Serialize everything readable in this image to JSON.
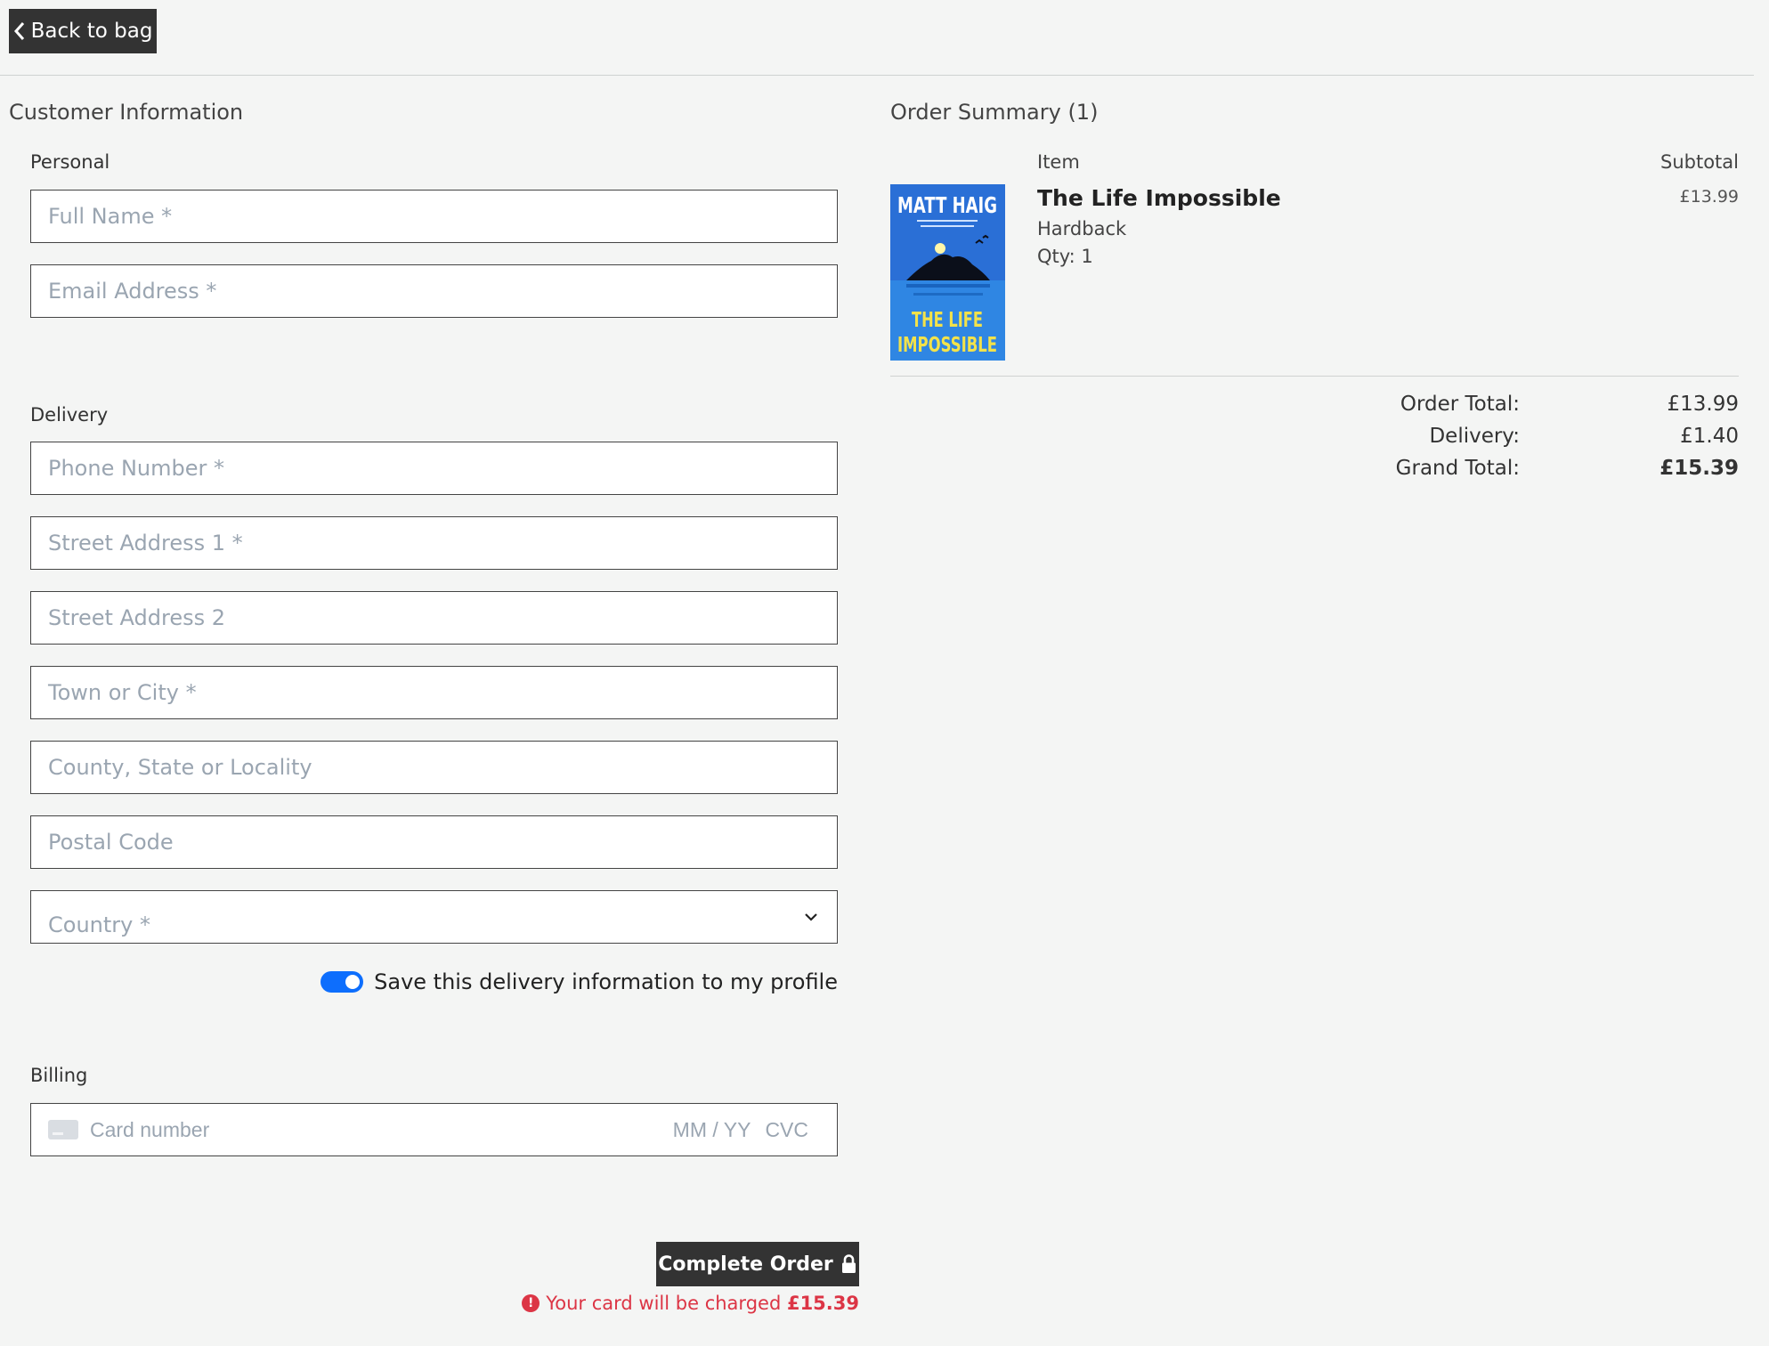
{
  "nav": {
    "back_label": "Back to bag"
  },
  "customer": {
    "heading": "Customer Information",
    "personal_label": "Personal",
    "full_name_placeholder": "Full Name *",
    "email_placeholder": "Email Address *",
    "delivery_label": "Delivery",
    "phone_placeholder": "Phone Number *",
    "street1_placeholder": "Street Address 1 *",
    "street2_placeholder": "Street Address 2",
    "town_placeholder": "Town or City *",
    "county_placeholder": "County, State or Locality",
    "postal_placeholder": "Postal Code",
    "country_placeholder": "Country *",
    "save_info_label": "Save this delivery information to my profile",
    "save_info_checked": true,
    "billing_label": "Billing",
    "card_number_placeholder": "Card number",
    "card_expiry_placeholder": "MM / YY",
    "card_cvc_placeholder": "CVC"
  },
  "actions": {
    "complete_label": "Complete Order",
    "charge_prefix": "Your card will be charged ",
    "charge_amount": "£15.39"
  },
  "summary": {
    "heading": "Order Summary (1)",
    "col_item": "Item",
    "col_subtotal": "Subtotal",
    "item": {
      "title": "The Life Impossible",
      "format": "Hardback",
      "qty": "Qty: 1",
      "subtotal": "£13.99",
      "cover_author": "MATT HAIG",
      "cover_title_line1": "THE LIFE",
      "cover_title_line2": "IMPOSSIBLE"
    },
    "order_total_label": "Order Total:",
    "order_total": "£13.99",
    "delivery_label": "Delivery:",
    "delivery": "£1.40",
    "grand_total_label": "Grand Total:",
    "grand_total": "£15.39"
  },
  "colors": {
    "dark_button": "#333333",
    "toggle_on": "#0d6efd",
    "error": "#dc3545",
    "cover_blue": "#2a6fd6",
    "cover_yellow": "#f3e24a"
  }
}
